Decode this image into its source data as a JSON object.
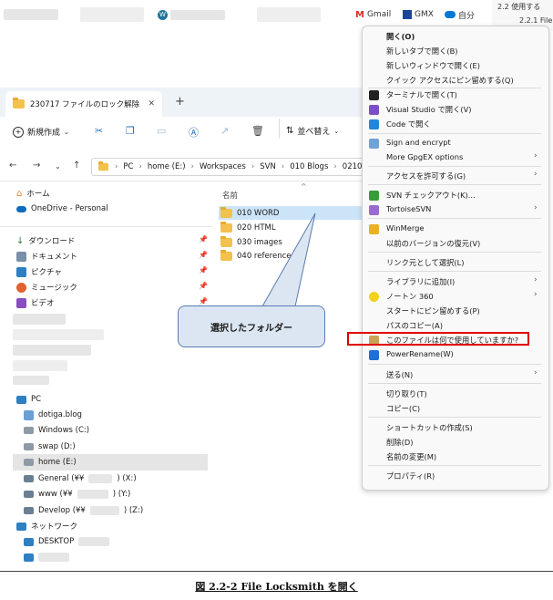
{
  "bookmarks": {
    "workspace": "Workspaces",
    "gmail": "Gmail",
    "gmx": "GMX",
    "msn_partial": "自分",
    "toc_line1": "2.2 使用する",
    "toc_line2": "2.2.1 File"
  },
  "explorer": {
    "tab_title": "230717 ファイルのロック解除",
    "new_button": "新規作成",
    "sort_button": "並べ替え",
    "breadcrumb": [
      "PC",
      "home (E:)",
      "Workspaces",
      "SVN",
      "010 Blogs",
      "0210"
    ],
    "sidebar": {
      "home": "ホーム",
      "onedrive": "OneDrive - Personal",
      "downloads": "ダウンロード",
      "documents": "ドキュメント",
      "pictures": "ピクチャ",
      "music": "ミュージック",
      "videos": "ビデオ",
      "pc": "PC",
      "dotiga": "dotiga.blog",
      "windows": "Windows (C:)",
      "swap": "swap (D:)",
      "home_e": "home (E:)",
      "general": "General (¥¥",
      "general_drive": ") (X:)",
      "www": "www (¥¥",
      "www_drive": ") (Y:)",
      "develop": "Develop (¥¥",
      "develop_drive": ") (Z:)",
      "network": "ネットワーク",
      "desktop": "DESKTOP"
    },
    "column_name": "名前",
    "folders": [
      "010 WORD",
      "020 HTML",
      "030 images",
      "040 references"
    ]
  },
  "callout": "選択したフォルダー",
  "menu": {
    "open": "開く(O)",
    "open_new_tab": "新しいタブで開く(B)",
    "open_new_window": "新しいウィンドウで開く(E)",
    "pin_quick": "クイック アクセスにピン留めする(Q)",
    "terminal": "ターミナルで開く(T)",
    "vs": "Visual Studio で開く(V)",
    "code": "Code で開く",
    "sign": "Sign and encrypt",
    "gpg": "More GpgEX options",
    "access": "アクセスを許可する(G)",
    "svn_checkout": "SVN チェックアウト(K)...",
    "tortoise": "TortoiseSVN",
    "winmerge": "WinMerge",
    "restore": "以前のバージョンの復元(V)",
    "include": "リンク元として選択(L)",
    "library": "ライブラリに追加(I)",
    "norton": "ノートン 360",
    "pin_start": "スタートにピン留めする(P)",
    "copy_path": "パスのコピー(A)",
    "locksmith": "このファイルは何で使用していますか?",
    "power_rename": "PowerRename(W)",
    "send_to": "送る(N)",
    "cut": "切り取り(T)",
    "copy": "コピー(C)",
    "shortcut": "ショートカットの作成(S)",
    "delete": "削除(D)",
    "rename": "名前の変更(M)",
    "properties": "プロパティ(R)"
  },
  "caption": "図 2.2-2 File Locksmith を開く",
  "colors": {
    "highlight_border": "#e00000",
    "selection": "#cce4f7",
    "callout_fill": "#dce6f2",
    "folder": "#f2c14e"
  }
}
